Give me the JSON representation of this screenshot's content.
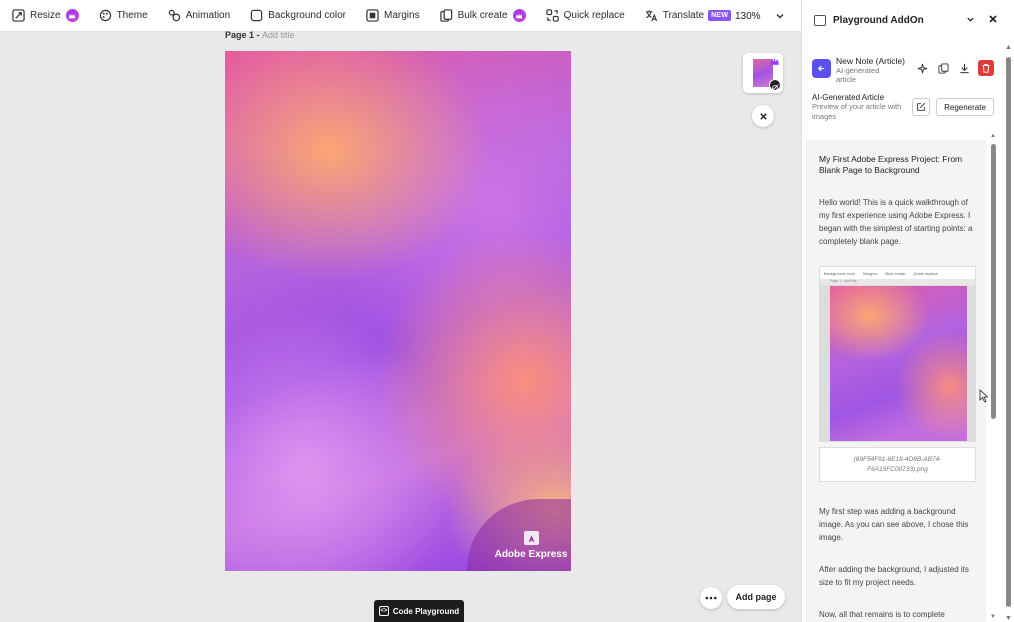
{
  "toolbar": {
    "resize": "Resize",
    "theme": "Theme",
    "animation": "Animation",
    "background_color": "Background color",
    "margins": "Margins",
    "bulk_create": "Bulk create",
    "quick_replace": "Quick replace",
    "translate": "Translate",
    "translate_badge": "NEW",
    "zoom": "130%"
  },
  "canvas": {
    "page_label": "Page 1 - ",
    "add_title": "Add title",
    "brand": "Adobe Express",
    "add_page": "Add page",
    "code_playground": "Code Playground"
  },
  "panel": {
    "title": "Playground AddOn",
    "note_title": "New Note (Article)",
    "note_subtitle": "AI-generated article",
    "ai_title": "AI-Generated Article",
    "ai_desc": "Preview of your article with images",
    "regenerate": "Regenerate",
    "article": {
      "heading": "My First Adobe Express Project: From Blank Page to Background",
      "p1": "Hello world! This is a quick walkthrough of my first experience using Adobe Express. I began with the simplest of starting points: a completely blank page.",
      "caption": "(89F54F91-8E18-4D8B-AB74-F6A15FC00733).png",
      "p2": "My first step was adding a background image. As you can see above, I chose this image.",
      "p3": "After adding the background, I adjusted its size to fit my project needs.",
      "p4": "Now, all that remains is to complete",
      "mini_toolbar": [
        "Background color",
        "Margins",
        "Bulk create",
        "Quick replace"
      ],
      "mini_page": "Page 1 - Add title"
    }
  },
  "colors": {
    "accent": "#5a4ff0",
    "delete": "#e03a3a",
    "badge": "#8b55f3"
  }
}
